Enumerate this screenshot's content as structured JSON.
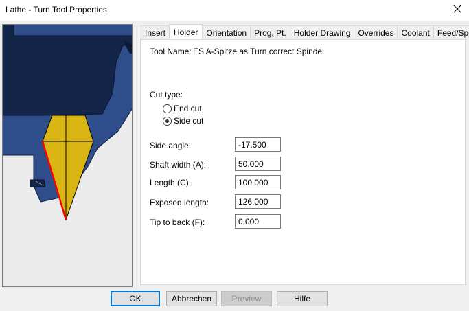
{
  "window": {
    "title": "Lathe - Turn Tool Properties"
  },
  "tabs": [
    {
      "label": "Insert"
    },
    {
      "label": "Holder",
      "active": true
    },
    {
      "label": "Orientation"
    },
    {
      "label": "Prog. Pt."
    },
    {
      "label": "Holder Drawing"
    },
    {
      "label": "Overrides"
    },
    {
      "label": "Coolant"
    },
    {
      "label": "Feed/Speed"
    }
  ],
  "holder": {
    "tool_name_label": "Tool Name:",
    "tool_name_value": "ES A-Spitze as Turn correct Spindel",
    "cut_type_label": "Cut type:",
    "cut_type_options": [
      {
        "label": "End cut",
        "selected": false
      },
      {
        "label": "Side cut",
        "selected": true
      }
    ],
    "fields": [
      {
        "label": "Side angle:",
        "value": "-17.500"
      },
      {
        "label": "Shaft width (A):",
        "value": "50.000"
      },
      {
        "label": "Length (C):",
        "value": "100.000"
      },
      {
        "label": "Exposed length:",
        "value": "126.000"
      },
      {
        "label": "Tip to back (F):",
        "value": "0.000"
      }
    ]
  },
  "buttons": {
    "ok": "OK",
    "cancel": "Abbrechen",
    "preview": "Preview",
    "help": "Hilfe"
  },
  "colors": {
    "holder_dark": "#13264a",
    "holder_blue": "#2e4d8a",
    "insert_yellow": "#d9b514",
    "cutting_edge": "#ff0000"
  },
  "icons": {
    "close": "close-icon"
  }
}
